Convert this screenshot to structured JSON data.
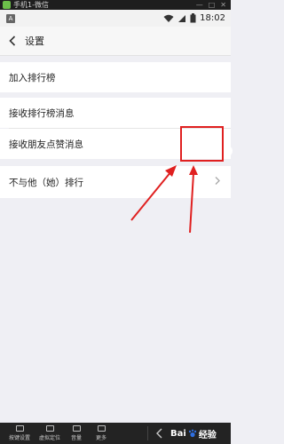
{
  "emulator": {
    "title": "手机1-微信",
    "controls": [
      "—",
      "□",
      "✕"
    ]
  },
  "status": {
    "badge": "A",
    "time": "18:02",
    "icons": [
      "wifi-icon",
      "signal-icon",
      "battery-icon"
    ]
  },
  "nav": {
    "title": "设置"
  },
  "settings": [
    {
      "label": "加入排行榜",
      "control": "toggle",
      "on": true
    },
    {
      "label": "接收排行榜消息",
      "control": "toggle",
      "on": true
    },
    {
      "label": "接收朋友点赞消息",
      "control": "toggle",
      "on": false
    },
    {
      "label": "不与他（她）排行",
      "control": "chevron"
    }
  ],
  "bottom": {
    "items": [
      "按键设置",
      "虚拟定位",
      "音量",
      "更多"
    ]
  },
  "watermark": {
    "brand": "Bai",
    "suffix": "经验"
  },
  "colors": {
    "toggle_on": "#20c35a",
    "toggle_off": "#d2d2d2",
    "annotation": "#e02020",
    "background": "#efeff4"
  }
}
